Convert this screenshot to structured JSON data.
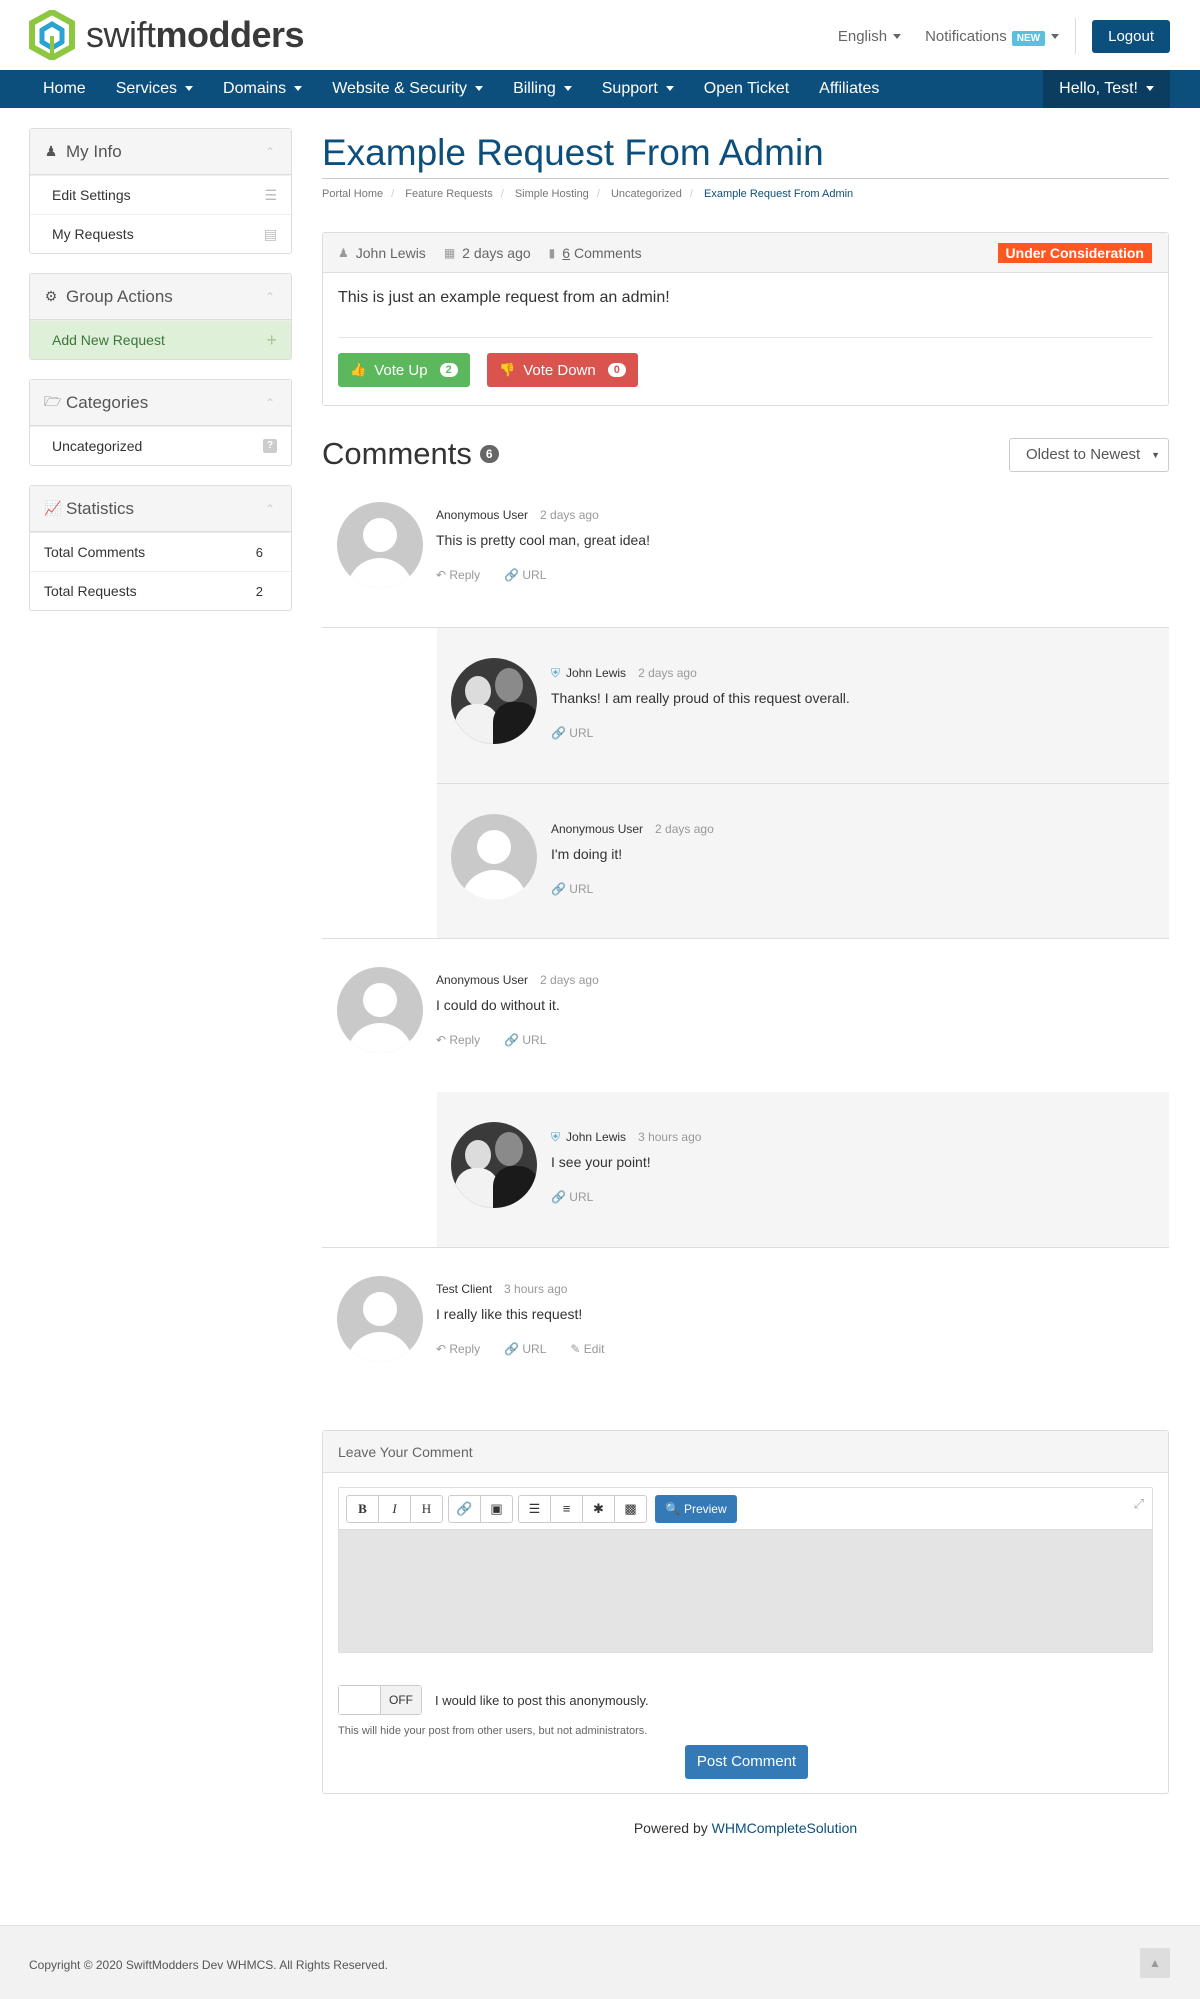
{
  "header": {
    "brand_light": "swift",
    "brand_bold": "modders",
    "language": "English",
    "notifications": "Notifications",
    "new_badge": "NEW",
    "logout": "Logout",
    "greeting": "Hello, Test!"
  },
  "nav": {
    "items": [
      "Home",
      "Services",
      "Domains",
      "Website & Security",
      "Billing",
      "Support",
      "Open Ticket",
      "Affiliates"
    ]
  },
  "sidebar": {
    "myinfo": {
      "title": "My Info",
      "items": [
        "Edit Settings",
        "My Requests"
      ]
    },
    "group": {
      "title": "Group Actions",
      "items": [
        "Add New Request"
      ]
    },
    "categories": {
      "title": "Categories",
      "items": [
        "Uncategorized"
      ],
      "icon_char": "?"
    },
    "statistics": {
      "title": "Statistics",
      "rows": [
        {
          "label": "Total Comments",
          "value": "6"
        },
        {
          "label": "Total Requests",
          "value": "2"
        }
      ]
    }
  },
  "page": {
    "title": "Example Request From Admin",
    "breadcrumb": [
      "Portal Home",
      "Feature Requests",
      "Simple Hosting",
      "Uncategorized",
      "Example Request From Admin"
    ]
  },
  "request": {
    "author": "John Lewis",
    "time": "2 days ago",
    "comments_count": "6",
    "comments_word": "Comments",
    "status": "Under Consideration",
    "body": "This is just an example request from an admin!",
    "vote_up": "Vote Up",
    "vote_up_count": "2",
    "vote_down": "Vote Down",
    "vote_down_count": "0"
  },
  "comments_section": {
    "heading": "Comments",
    "count": "6",
    "sort": "Oldest to Newest"
  },
  "comments": [
    {
      "author": "Anonymous User",
      "time": "2 days ago",
      "text": "This is pretty cool man, great idea!",
      "reply": "Reply",
      "url": "URL"
    },
    {
      "author": "John Lewis",
      "time": "2 days ago",
      "text": "Thanks! I am really proud of this request overall.",
      "url": "URL"
    },
    {
      "author": "Anonymous User",
      "time": "2 days ago",
      "text": "I'm doing it!",
      "url": "URL"
    },
    {
      "author": "Anonymous User",
      "time": "2 days ago",
      "text": "I could do without it.",
      "reply": "Reply",
      "url": "URL"
    },
    {
      "author": "John Lewis",
      "time": "3 hours ago",
      "text": "I see your point!",
      "url": "URL"
    },
    {
      "author": "Test Client",
      "time": "3 hours ago",
      "text": "I really like this request!",
      "reply": "Reply",
      "url": "URL",
      "edit": "Edit"
    }
  ],
  "leave_comment": {
    "title": "Leave Your Comment",
    "toolbar": {
      "bold": "B",
      "italic": "I",
      "heading": "H"
    },
    "preview": "Preview",
    "toggle": "OFF",
    "anon_label": "I would like to post this anonymously.",
    "help": "This will hide your post from other users, but not administrators.",
    "submit": "Post Comment"
  },
  "powered": {
    "prefix": "Powered by",
    "link": "WHMCompleteSolution"
  },
  "footer": {
    "copyright": "Copyright © 2020 SwiftModders Dev WHMCS. All Rights Reserved."
  },
  "colors": {
    "brand": "#0d4f7c",
    "status": "#ff5722",
    "vote_up": "#5cb85c",
    "vote_down": "#d9534f"
  }
}
